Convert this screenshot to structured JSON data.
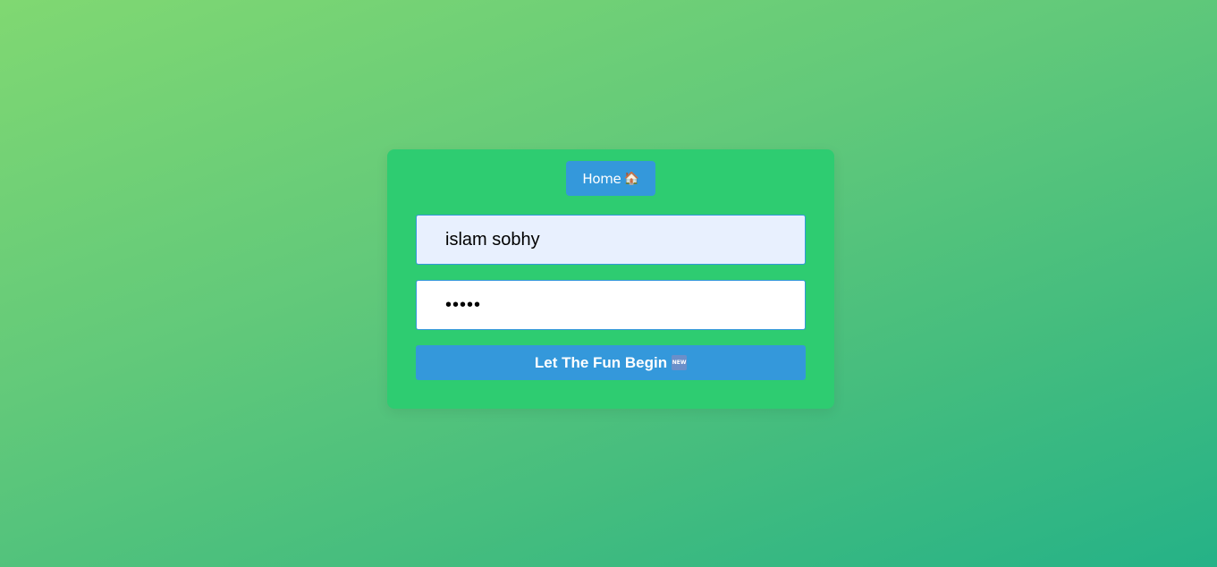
{
  "home_button": {
    "label": "Home",
    "icon": "🏠"
  },
  "username_field": {
    "value": "islam sobhy"
  },
  "password_field": {
    "value": "12345"
  },
  "submit_button": {
    "label": "Let The Fun Begin",
    "icon_text": "NEW"
  },
  "colors": {
    "card": "#2ecc71",
    "button": "#3498db",
    "autofill": "#e8f0fe"
  }
}
